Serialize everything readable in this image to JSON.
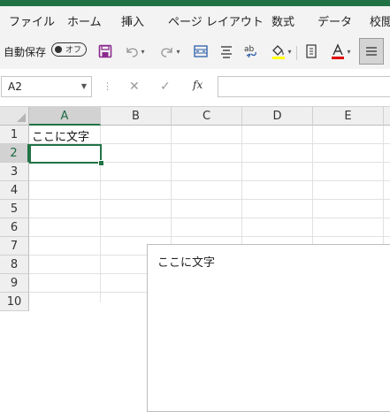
{
  "ribbon": {
    "tabs": [
      "ファイル",
      "ホーム",
      "挿入",
      "ページ レイアウト",
      "数式",
      "データ",
      "校閲"
    ]
  },
  "toolbar": {
    "autosave_label": "自動保存",
    "autosave_state": "オフ",
    "icons": [
      "save-icon",
      "undo-icon",
      "redo-icon",
      "merge-center-icon",
      "align-center-icon",
      "spelling-icon",
      "fill-color-icon",
      "number-format-icon",
      "font-color-icon",
      "align-menu-icon"
    ],
    "accent_colors": {
      "save": "#8b2a8e",
      "fill": "#ffff00",
      "font": "#e00000",
      "brand": "#217346"
    }
  },
  "formula_bar": {
    "name_box": "A2",
    "fx_label": "fx",
    "formula": ""
  },
  "sheet": {
    "columns": [
      "A",
      "B",
      "C",
      "D",
      "E"
    ],
    "rows": [
      "1",
      "2",
      "3",
      "4",
      "5",
      "6",
      "7",
      "8",
      "9",
      "10"
    ],
    "selected_column": "A",
    "selected_row": "2",
    "cells": {
      "A1": "ここに文字"
    }
  },
  "text_box": {
    "text": "ここに文字"
  }
}
